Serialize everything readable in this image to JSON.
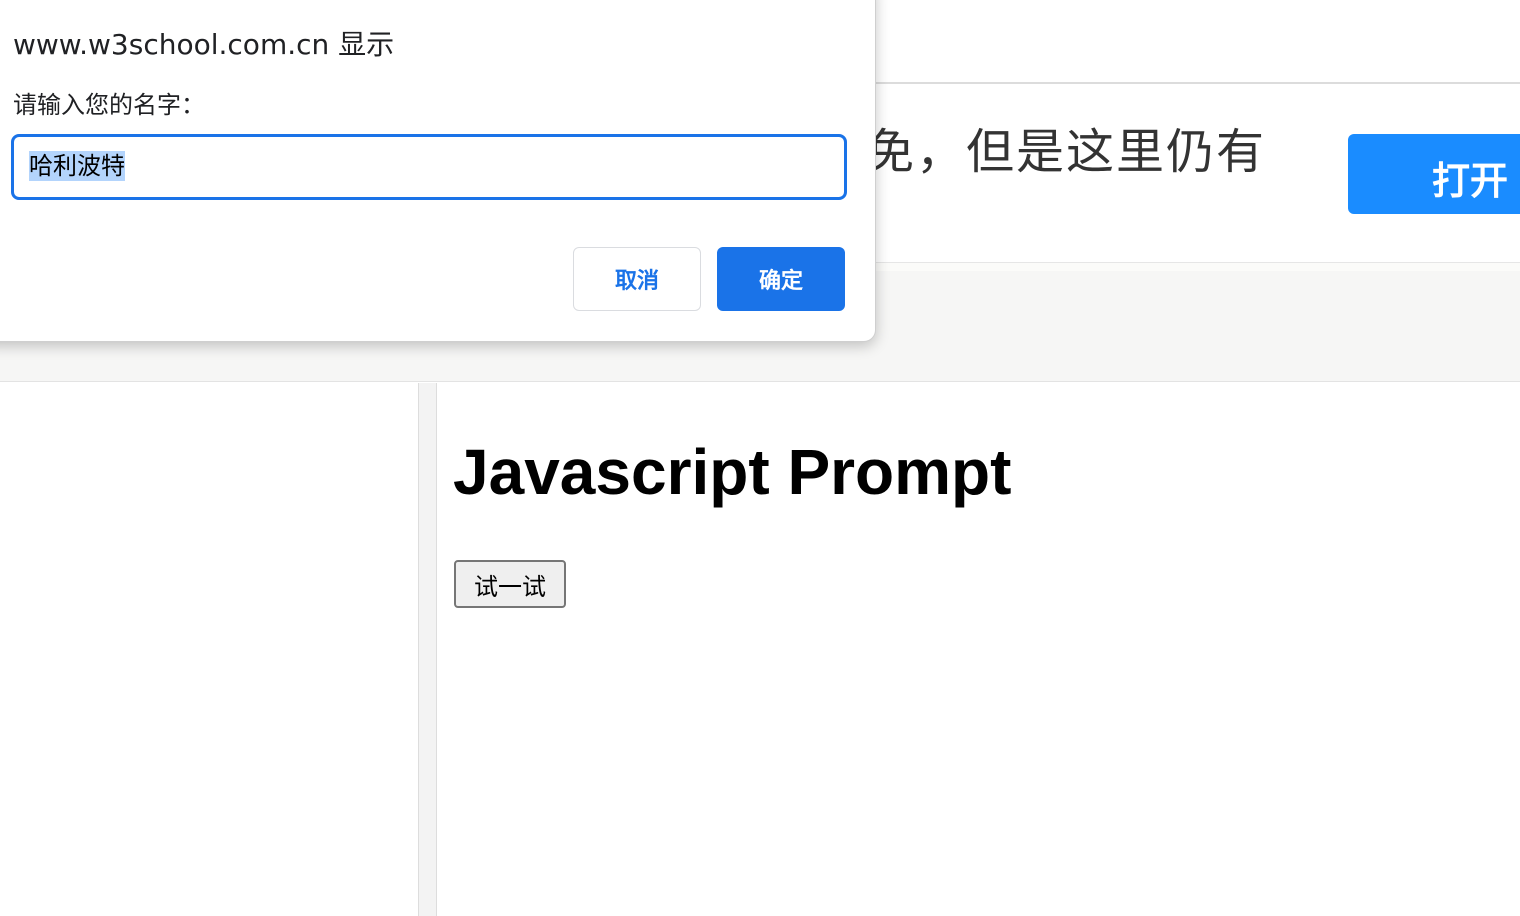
{
  "background_page": {
    "banner": {
      "text": "免，但是这里仍有",
      "button_label": "打开"
    },
    "result": {
      "heading": "Javascript Prompt",
      "button_label": "试一试"
    }
  },
  "dialog": {
    "title": "www.w3school.com.cn 显示",
    "message": "请输入您的名字：",
    "input_value": "哈利波特",
    "cancel_label": "取消",
    "ok_label": "确定"
  },
  "colors": {
    "accent": "#1a73e8",
    "banner_button": "#1a8cff",
    "selection": "#b3d4fc"
  }
}
